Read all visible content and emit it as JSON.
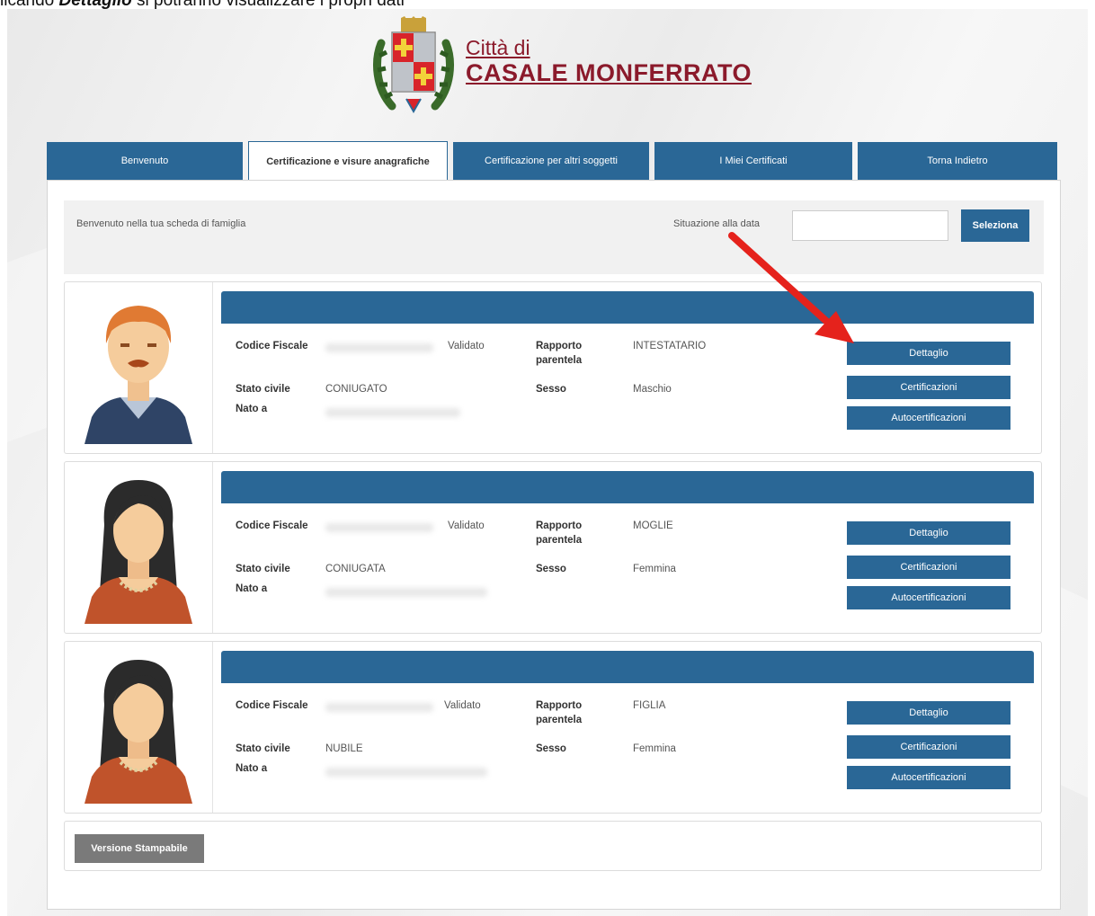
{
  "caption": {
    "prefix": "licando ",
    "bold": "Dettaglio",
    "suffix": " si potranno visualizzare i propri dati"
  },
  "brand": {
    "line1": "Città di",
    "line2": "CASALE MONFERRATO"
  },
  "tabs": [
    {
      "label": "Benvenuto"
    },
    {
      "label": "Certificazione e visure anagrafiche"
    },
    {
      "label": "Certificazione per altri soggetti"
    },
    {
      "label": "I Miei Certificati"
    },
    {
      "label": "Torna Indietro"
    }
  ],
  "filter": {
    "welcome": "Benvenuto nella tua scheda di famiglia",
    "date_label": "Situazione alla data",
    "date_value": "",
    "select_label": "Seleziona"
  },
  "field_labels": {
    "codice_fiscale": "Codice Fiscale",
    "rapporto_line1": "Rapporto",
    "rapporto_line2": "parentela",
    "stato_civile": "Stato civile",
    "sesso": "Sesso",
    "nato_a": "Nato a"
  },
  "members": [
    {
      "avatar": "male-avatar",
      "validato": "Validato",
      "rapporto": "INTESTATARIO",
      "stato_civile": "CONIUGATO",
      "sesso": "Maschio"
    },
    {
      "avatar": "female-avatar",
      "validato": "Validato",
      "rapporto": "MOGLIE",
      "stato_civile": "CONIUGATA",
      "sesso": "Femmina"
    },
    {
      "avatar": "female-avatar",
      "validato": "Validato",
      "rapporto": "FIGLIA",
      "stato_civile": "NUBILE",
      "sesso": "Femmina"
    }
  ],
  "actions": {
    "detail": "Dettaglio",
    "cert": "Certificazioni",
    "autocert": "Autocertificazioni"
  },
  "print_label": "Versione Stampabile",
  "colors": {
    "primary": "#2a6796",
    "brand": "#8b1a2b",
    "arrow": "#e5221c",
    "print_button": "#7a7a7a"
  }
}
